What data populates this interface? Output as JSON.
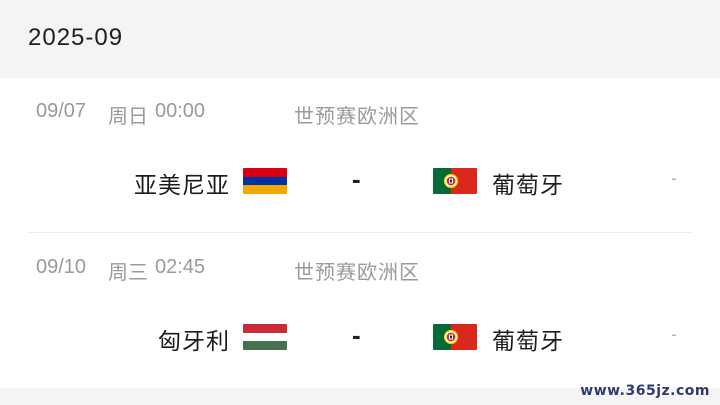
{
  "header": {
    "month": "2025-09"
  },
  "matches": [
    {
      "date": "09/07",
      "weekday": "周日",
      "time": "00:00",
      "competition": "世预赛欧洲区",
      "home": {
        "name": "亚美尼亚",
        "flag_icon": "armenia-flag-icon"
      },
      "separator": "-",
      "away": {
        "name": "葡萄牙",
        "flag_icon": "portugal-flag-icon"
      },
      "result": "-"
    },
    {
      "date": "09/10",
      "weekday": "周三",
      "time": "02:45",
      "competition": "世预赛欧洲区",
      "home": {
        "name": "匈牙利",
        "flag_icon": "hungary-flag-icon"
      },
      "separator": "-",
      "away": {
        "name": "葡萄牙",
        "flag_icon": "portugal-flag-icon"
      },
      "result": "-"
    }
  ],
  "watermark": "www.365jz.com",
  "colors": {
    "header_bg": "#f4f4f6",
    "muted_text": "#9a9a9a",
    "armenia": [
      "#d90012",
      "#0033a0",
      "#f2a800"
    ],
    "hungary": [
      "#ce2939",
      "#ffffff",
      "#477050"
    ],
    "portugal_green": "#046a38",
    "portugal_red": "#da291c"
  }
}
